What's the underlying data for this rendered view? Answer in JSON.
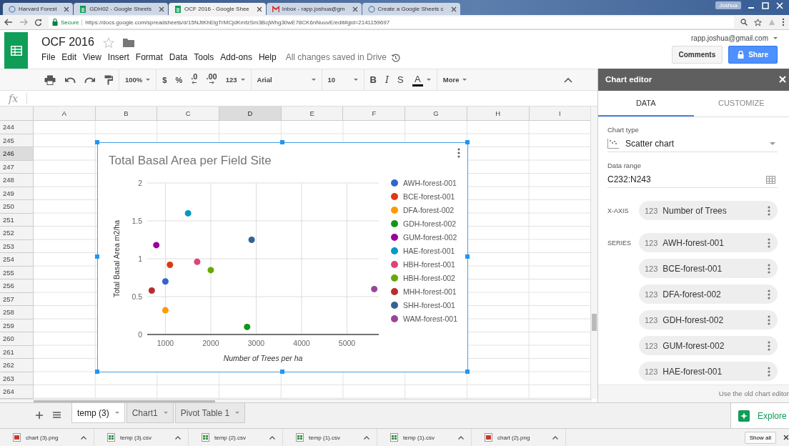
{
  "browser": {
    "tabs": [
      {
        "title": "Harvard Forest",
        "kind": "page",
        "selected": false
      },
      {
        "title": "GDH02 - Google Sheets",
        "kind": "sheets",
        "selected": false
      },
      {
        "title": "OCF 2016 - Google Shee",
        "kind": "sheets",
        "selected": true
      },
      {
        "title": "Inbox - rapp.joshua@gm",
        "kind": "mail",
        "selected": false
      },
      {
        "title": "Create a Google Sheets c",
        "kind": "page",
        "selected": false
      }
    ],
    "profile": "Joshua",
    "address": {
      "secure_label": "Secure",
      "url": "https://docs.google.com/spreadsheets/d/15NJtKhElgTrMCjdKmfzSm3BcjWhg30wE78CK6nNuuvE/edit#gid=2141159697"
    }
  },
  "doc": {
    "title": "OCF 2016",
    "menus": [
      "File",
      "Edit",
      "View",
      "Insert",
      "Format",
      "Data",
      "Tools",
      "Add-ons",
      "Help"
    ],
    "save_status": "All changes saved in Drive",
    "account": "rapp.joshua@gmail.com",
    "buttons": [
      {
        "label": "Comments",
        "kind": "plain"
      },
      {
        "label": "Share",
        "kind": "primary"
      }
    ]
  },
  "toolbar": [
    {
      "kind": "print"
    },
    {
      "kind": "undo"
    },
    {
      "kind": "redo"
    },
    {
      "kind": "paint"
    },
    {
      "kind": "sep"
    },
    {
      "kind": "dropdown",
      "label": "100%"
    },
    {
      "kind": "sep"
    },
    {
      "kind": "glyph",
      "label": "$"
    },
    {
      "kind": "glyph",
      "label": "%"
    },
    {
      "kind": "decrease",
      "label": ".0"
    },
    {
      "kind": "increase",
      "label": ".00"
    },
    {
      "kind": "dropdown",
      "label": "123"
    },
    {
      "kind": "sep"
    },
    {
      "kind": "font",
      "label": "Arial"
    },
    {
      "kind": "sep"
    },
    {
      "kind": "size",
      "label": "10"
    },
    {
      "kind": "sep"
    },
    {
      "kind": "bold",
      "label": "B"
    },
    {
      "kind": "italic",
      "label": "I"
    },
    {
      "kind": "strike",
      "label": "S"
    },
    {
      "kind": "textcolor",
      "label": "A"
    },
    {
      "kind": "sep"
    },
    {
      "kind": "dropdown",
      "label": "More"
    }
  ],
  "formula_bar": {
    "label": "fx"
  },
  "grid": {
    "columns": [
      {
        "label": "A",
        "selected": false
      },
      {
        "label": "B",
        "selected": false
      },
      {
        "label": "C",
        "selected": false
      },
      {
        "label": "D",
        "selected": true
      },
      {
        "label": "E",
        "selected": false
      },
      {
        "label": "F",
        "selected": false
      },
      {
        "label": "G",
        "selected": false
      },
      {
        "label": "H",
        "selected": false
      },
      {
        "label": "I",
        "selected": false
      }
    ],
    "rows": [
      {
        "label": "244",
        "selected": false
      },
      {
        "label": "245",
        "selected": false
      },
      {
        "label": "246",
        "selected": true
      },
      {
        "label": "247",
        "selected": false
      },
      {
        "label": "248",
        "selected": false
      },
      {
        "label": "249",
        "selected": false
      },
      {
        "label": "250",
        "selected": false
      },
      {
        "label": "251",
        "selected": false
      },
      {
        "label": "252",
        "selected": false
      },
      {
        "label": "253",
        "selected": false
      },
      {
        "label": "254",
        "selected": false
      },
      {
        "label": "255",
        "selected": false
      },
      {
        "label": "256",
        "selected": false
      },
      {
        "label": "257",
        "selected": false
      },
      {
        "label": "258",
        "selected": false
      },
      {
        "label": "259",
        "selected": false
      },
      {
        "label": "260",
        "selected": false
      },
      {
        "label": "261",
        "selected": false
      },
      {
        "label": "262",
        "selected": false
      },
      {
        "label": "263",
        "selected": false
      },
      {
        "label": "264",
        "selected": false
      }
    ]
  },
  "chart": {
    "chart_data": {
      "type": "scatter",
      "title": "Total Basal Area per Field Site",
      "xlabel": "Number of Trees per ha",
      "ylabel": "Total Basal Area m2/ha",
      "grid": true,
      "legend": true,
      "xlim": [
        600,
        5700
      ],
      "ylim": [
        0,
        2
      ],
      "xticks": [
        1000,
        2000,
        3000,
        4000,
        5000
      ],
      "yticks": [
        0,
        0.5,
        {
          "value": 1,
          "label": "1"
        },
        1.5,
        {
          "value": 2,
          "label": "2"
        }
      ],
      "x": [
        1000,
        1100,
        1000,
        2800,
        800,
        1500,
        1700,
        2000,
        700,
        2900,
        5600
      ],
      "series": [
        {
          "name": "AWH-forest-001",
          "color": "#3366cc",
          "values": [
            0.7,
            null,
            null,
            null,
            null,
            null,
            null,
            null,
            null,
            null,
            null
          ]
        },
        {
          "name": "BCE-forest-001",
          "color": "#dc3912",
          "values": [
            null,
            0.92,
            null,
            null,
            null,
            null,
            null,
            null,
            null,
            null,
            null
          ]
        },
        {
          "name": "DFA-forest-002",
          "color": "#ff9900",
          "values": [
            null,
            null,
            0.32,
            null,
            null,
            null,
            null,
            null,
            null,
            null,
            null
          ]
        },
        {
          "name": "GDH-forest-002",
          "color": "#109618",
          "values": [
            null,
            null,
            null,
            0.1,
            null,
            null,
            null,
            null,
            null,
            null,
            null
          ]
        },
        {
          "name": "GUM-forest-002",
          "color": "#990099",
          "values": [
            null,
            null,
            null,
            null,
            1.18,
            null,
            null,
            null,
            null,
            null,
            null
          ]
        },
        {
          "name": "HAE-forest-001",
          "color": "#0099c6",
          "values": [
            null,
            null,
            null,
            null,
            null,
            1.6,
            null,
            null,
            null,
            null,
            null
          ]
        },
        {
          "name": "HBH-forest-001",
          "color": "#dd4477",
          "values": [
            null,
            null,
            null,
            null,
            null,
            null,
            0.96,
            null,
            null,
            null,
            null
          ]
        },
        {
          "name": "HBH-forest-002",
          "color": "#66aa00",
          "values": [
            null,
            null,
            null,
            null,
            null,
            null,
            null,
            0.85,
            null,
            null,
            null
          ]
        },
        {
          "name": "MHH-forest-001",
          "color": "#b82e2e",
          "values": [
            null,
            null,
            null,
            null,
            null,
            null,
            null,
            null,
            0.58,
            null,
            null
          ]
        },
        {
          "name": "SHH-forest-001",
          "color": "#316395",
          "values": [
            null,
            null,
            null,
            null,
            null,
            null,
            null,
            null,
            null,
            1.25,
            null
          ]
        },
        {
          "name": "WAM-forest-001",
          "color": "#994499",
          "values": [
            null,
            null,
            null,
            null,
            null,
            null,
            null,
            null,
            null,
            null,
            0.6
          ]
        }
      ]
    }
  },
  "chart_editor": {
    "title": "Chart editor",
    "tabs": [
      {
        "label": "DATA",
        "selected": true
      },
      {
        "label": "CUSTOMIZE",
        "selected": false
      }
    ],
    "chart_type": {
      "label": "Chart type",
      "value": "Scatter chart"
    },
    "data_range": {
      "label": "Data range",
      "value": "C232:N243"
    },
    "x_axis": {
      "label": "X-AXIS",
      "chip": {
        "type": "123",
        "name": "Number of Trees"
      }
    },
    "series": {
      "label": "SERIES",
      "chips": [
        {
          "type": "123",
          "name": "AWH-forest-001"
        },
        {
          "type": "123",
          "name": "BCE-forest-001"
        },
        {
          "type": "123",
          "name": "DFA-forest-002"
        },
        {
          "type": "123",
          "name": "GDH-forest-002"
        },
        {
          "type": "123",
          "name": "GUM-forest-002"
        },
        {
          "type": "123",
          "name": "HAE-forest-001"
        }
      ]
    },
    "footer_link": "Use the old chart editor"
  },
  "sheet_tabs": [
    {
      "label": "temp (3)",
      "selected": true
    },
    {
      "label": "Chart1",
      "selected": false
    },
    {
      "label": "Pivot Table 1",
      "selected": false
    }
  ],
  "explore": {
    "label": "Explore"
  },
  "downloads": {
    "items": [
      {
        "name": "chart (3).png",
        "kind": "image"
      },
      {
        "name": "temp (3).csv",
        "kind": "sheet"
      },
      {
        "name": "temp (2).csv",
        "kind": "sheet"
      },
      {
        "name": "temp (1).csv",
        "kind": "sheet"
      },
      {
        "name": "temp (1).csv",
        "kind": "sheet"
      },
      {
        "name": "chart (2).png",
        "kind": "image"
      }
    ],
    "show_all": "Show all"
  }
}
